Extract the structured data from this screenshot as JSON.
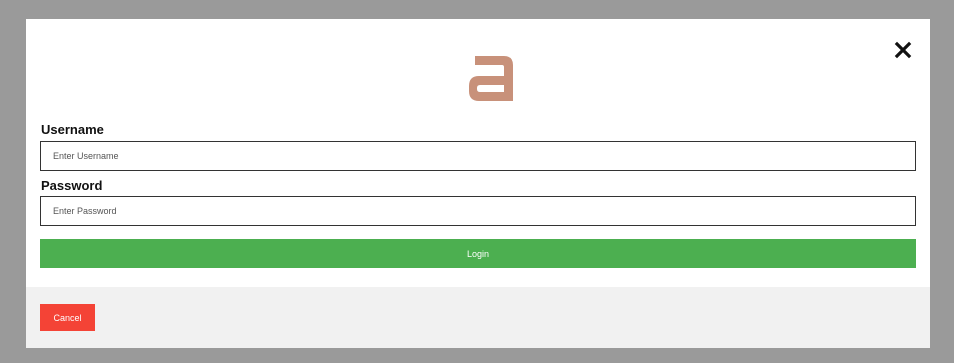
{
  "colors": {
    "logo": "#c8917a",
    "login_button": "#4caf50",
    "cancel_button": "#f44336",
    "footer_background": "#f1f1f1",
    "overlay_background": "#9a9a9a"
  },
  "header": {
    "logo_icon": "brand-logo-a",
    "close_icon": "close-x"
  },
  "form": {
    "username": {
      "label": "Username",
      "placeholder": "Enter Username",
      "value": ""
    },
    "password": {
      "label": "Password",
      "placeholder": "Enter Password",
      "value": ""
    },
    "login_label": "Login"
  },
  "footer": {
    "cancel_label": "Cancel"
  }
}
